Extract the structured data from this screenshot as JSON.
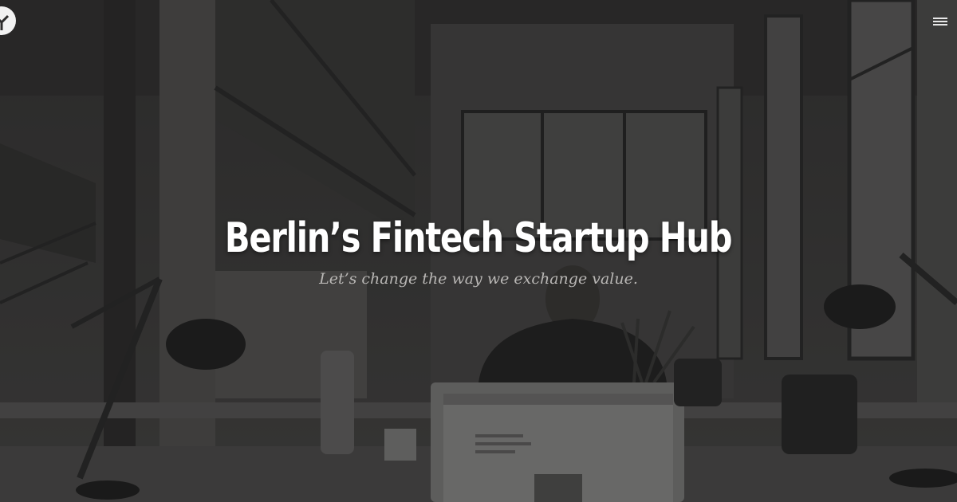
{
  "hero": {
    "title": "Berlin’s Fintech Startup Hub",
    "tagline": "Let’s change the way we exchange value."
  },
  "header": {
    "logo_icon": "circle-y-logo-icon",
    "menu_icon": "hamburger-menu-icon"
  },
  "colors": {
    "title": "#ffffff",
    "tagline": "#b9b7b5",
    "overlay": "rgba(20,20,20,0.38)"
  }
}
